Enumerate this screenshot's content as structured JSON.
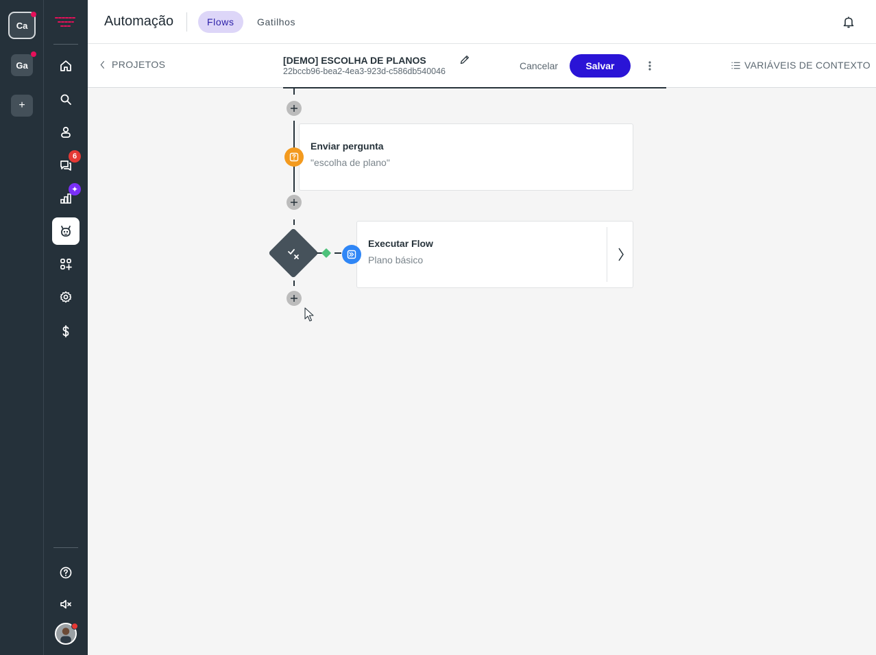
{
  "workspaces": [
    {
      "label": "Ca",
      "active": true,
      "has_notification": true
    },
    {
      "label": "Ga",
      "active": false,
      "has_notification": true
    },
    {
      "label": "+",
      "active": false,
      "has_notification": false
    }
  ],
  "nav": {
    "items": [
      {
        "name": "home-icon"
      },
      {
        "name": "search-icon"
      },
      {
        "name": "contacts-icon"
      },
      {
        "name": "chats-icon",
        "badge": "6"
      },
      {
        "name": "reports-icon",
        "badge": "✦"
      },
      {
        "name": "bot-icon",
        "active": true
      },
      {
        "name": "apps-icon"
      },
      {
        "name": "settings-icon"
      },
      {
        "name": "billing-icon"
      }
    ],
    "bottom": [
      {
        "name": "help-icon"
      },
      {
        "name": "mute-icon"
      }
    ]
  },
  "header": {
    "title": "Automação",
    "tabs": [
      {
        "label": "Flows",
        "active": true
      },
      {
        "label": "Gatilhos",
        "active": false
      }
    ]
  },
  "subheader": {
    "back_label": "PROJETOS",
    "flow_name": "[DEMO] ESCOLHA DE PLANOS",
    "flow_id": "22bccb96-bea2-4ea3-923d-c586db540046",
    "cancel_label": "Cancelar",
    "save_label": "Salvar",
    "context_label": "VARIÁVEIS DE CONTEXTO"
  },
  "flow": {
    "nodes": [
      {
        "type": "question",
        "title": "Enviar pergunta",
        "subtitle": "\"escolha de plano\"",
        "icon": "question-icon",
        "color": "#f39a1e"
      },
      {
        "type": "condition",
        "icon": "check-x-icon"
      },
      {
        "type": "run-flow",
        "title": "Executar Flow",
        "subtitle": "Plano básico",
        "icon": "run-flow-icon",
        "color": "#2f86f6"
      }
    ]
  },
  "colors": {
    "sidebar": "#25313a",
    "accent": "#2a14d6",
    "tab_active_bg": "#ddd6f8",
    "notification": "#e6105a"
  }
}
